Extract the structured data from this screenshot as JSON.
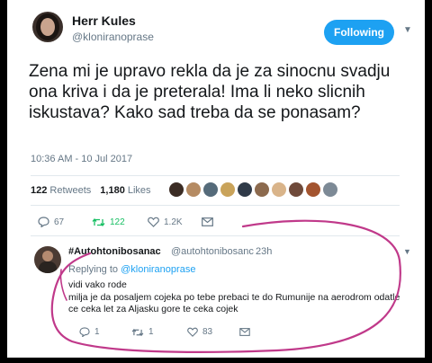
{
  "tweet": {
    "author_name": "Herr Kules",
    "author_handle": "@kloniranoprase",
    "follow_label": "Following",
    "text": "Zena mi je upravo rekla da je za sinocnu svadju ona kriva i da je preterala! Ima li neko slicnih iskustava? Kako sad treba da se ponasam?",
    "timestamp": "10:36 AM - 10 Jul 2017",
    "retweets_count": "122",
    "retweets_label": "Retweets",
    "likes_count": "1,180",
    "likes_label": "Likes",
    "actions": {
      "reply_count": "67",
      "retweet_count": "122",
      "like_count": "1.2K"
    }
  },
  "reply": {
    "author_name": "#Autohtonibosanac",
    "author_handle": "@autohtonibosanc",
    "time": "23h",
    "replying_prefix": "Replying to",
    "replying_to": "@kloniranoprase",
    "line1": "vidi vako rode",
    "line2": "milja je da posaljem cojeka po tebe prebaci te do Rumunije na aerodrom odatle ce ceka let za Aljasku gore te ceka cojek",
    "actions": {
      "reply_count": "1",
      "retweet_count": "1",
      "like_count": "83"
    }
  },
  "colors": {
    "accent": "#1da1f2",
    "retweet": "#17bf63",
    "annotation": "#c0398a"
  },
  "icons": [
    "reply-icon",
    "retweet-icon",
    "like-icon",
    "message-icon",
    "chevron-down-icon"
  ]
}
